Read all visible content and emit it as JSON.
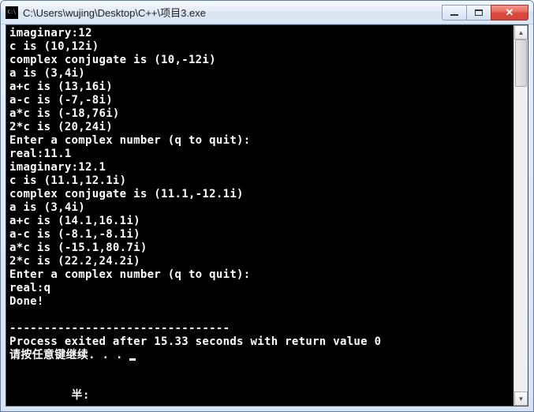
{
  "window": {
    "title": "C:\\Users\\wujing\\Desktop\\C++\\项目3.exe"
  },
  "console": {
    "lines": [
      "imaginary:12",
      "c is (10,12i)",
      "complex conjugate is (10,-12i)",
      "a is (3,4i)",
      "a+c is (13,16i)",
      "a-c is (-7,-8i)",
      "a*c is (-18,76i)",
      "2*c is (20,24i)",
      "Enter a complex number (q to quit):",
      "real:11.1",
      "imaginary:12.1",
      "c is (11.1,12.1i)",
      "complex conjugate is (11.1,-12.1i)",
      "a is (3,4i)",
      "a+c is (14.1,16.1i)",
      "a-c is (-8.1,-8.1i)",
      "a*c is (-15.1,80.7i)",
      "2*c is (22.2,24.2i)",
      "Enter a complex number (q to quit):",
      "real:q",
      "Done!",
      "",
      "--------------------------------",
      "Process exited after 15.33 seconds with return value 0",
      "请按任意键继续. . . ",
      "",
      "",
      "         半:"
    ]
  }
}
